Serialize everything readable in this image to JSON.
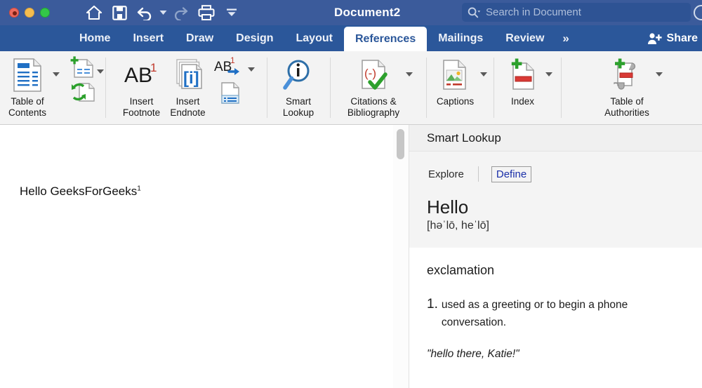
{
  "titlebar": {
    "window_controls": [
      "close",
      "minimize",
      "maximize"
    ],
    "quick_access": [
      {
        "name": "home-icon",
        "label": "Home"
      },
      {
        "name": "save-icon",
        "label": "Save"
      },
      {
        "name": "undo-icon",
        "label": "Undo"
      },
      {
        "name": "redo-icon",
        "label": "Redo"
      },
      {
        "name": "print-icon",
        "label": "Print"
      },
      {
        "name": "customize-toolbar-icon",
        "label": "Customize Toolbar"
      }
    ],
    "document_title": "Document2",
    "search": {
      "placeholder": "Search in Document",
      "value": "",
      "icon": "search-icon"
    }
  },
  "tabs": {
    "items": [
      "Home",
      "Insert",
      "Draw",
      "Design",
      "Layout",
      "References",
      "Mailings",
      "Review"
    ],
    "active": "References",
    "overflow_label": "»",
    "share_label": "Share"
  },
  "ribbon": {
    "groups": [
      {
        "name": "table-of-contents",
        "commands": [
          {
            "label": "Table of\nContents",
            "icon": "table-of-contents-icon",
            "has_caret": true
          },
          {
            "label": "",
            "icon": "add-text-icon",
            "has_caret": true
          },
          {
            "label": "",
            "icon": "update-table-icon",
            "has_caret": false
          }
        ]
      },
      {
        "name": "footnotes",
        "commands": [
          {
            "label": "Insert\nFootnote",
            "icon": "insert-footnote-icon",
            "has_caret": false
          },
          {
            "label": "Insert\nEndnote",
            "icon": "insert-endnote-icon",
            "has_caret": false
          },
          {
            "label": "",
            "icon": "next-footnote-icon",
            "has_caret": true
          },
          {
            "label": "",
            "icon": "show-notes-icon",
            "has_caret": false
          }
        ]
      },
      {
        "name": "smart-lookup",
        "commands": [
          {
            "label": "Smart\nLookup",
            "icon": "smart-lookup-icon",
            "has_caret": false
          }
        ]
      },
      {
        "name": "citations",
        "commands": [
          {
            "label": "Citations &\nBibliography",
            "icon": "citations-icon",
            "has_caret": true
          }
        ]
      },
      {
        "name": "captions",
        "commands": [
          {
            "label": "Captions",
            "icon": "captions-icon",
            "has_caret": true
          }
        ]
      },
      {
        "name": "index",
        "commands": [
          {
            "label": "Index",
            "icon": "index-icon",
            "has_caret": true
          }
        ]
      },
      {
        "name": "table-of-authorities",
        "commands": [
          {
            "label": "Table of\nAuthorities",
            "icon": "table-of-authorities-icon",
            "has_caret": true
          }
        ]
      }
    ]
  },
  "document": {
    "body_text": "Hello GeeksForGeeks",
    "footnote_marker": "1"
  },
  "panel": {
    "title": "Smart Lookup",
    "tabs": [
      {
        "label": "Explore",
        "active": false
      },
      {
        "label": "Define",
        "active": true
      }
    ],
    "word": "Hello",
    "pronunciation": "[həˈlō, heˈlō]",
    "part_of_speech": "exclamation",
    "definitions": [
      {
        "number": "1.",
        "text": "used as a greeting or to begin a phone conversation.",
        "example": "\"hello there, Katie!\""
      }
    ]
  },
  "colors": {
    "titlebar_blue": "#3B5B9B",
    "tabbar_blue": "#2B579A",
    "ribbon_gray": "#F3F3F3",
    "panel_gray": "#F4F4F4",
    "define_blue": "#1A2FA8"
  }
}
